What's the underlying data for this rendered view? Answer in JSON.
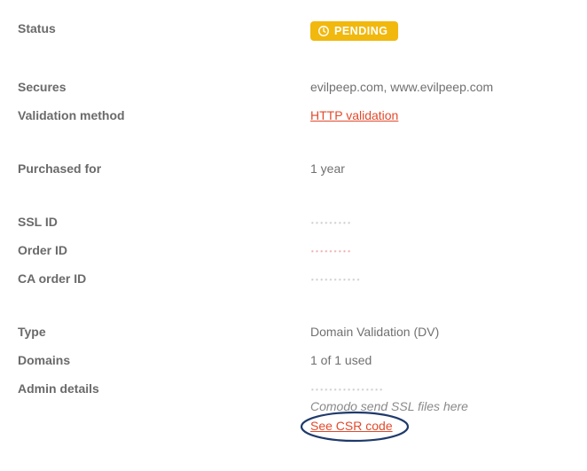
{
  "status": {
    "label": "Status",
    "badge": "PENDING"
  },
  "secures": {
    "label": "Secures",
    "value": "evilpeep.com, www.evilpeep.com"
  },
  "validation": {
    "label": "Validation method",
    "link": "HTTP validation"
  },
  "purchased": {
    "label": "Purchased for",
    "value": "1 year"
  },
  "ssl_id": {
    "label": "SSL ID",
    "value": "·········"
  },
  "order_id": {
    "label": "Order ID",
    "value": "·········"
  },
  "ca_order_id": {
    "label": "CA order ID",
    "value": "···········"
  },
  "type": {
    "label": "Type",
    "value": "Domain Validation (DV)"
  },
  "domains": {
    "label": "Domains",
    "value": "1 of 1 used"
  },
  "admin": {
    "label": "Admin details",
    "value": "················",
    "hint": "Comodo send SSL files here",
    "csr_link": "See CSR code"
  }
}
